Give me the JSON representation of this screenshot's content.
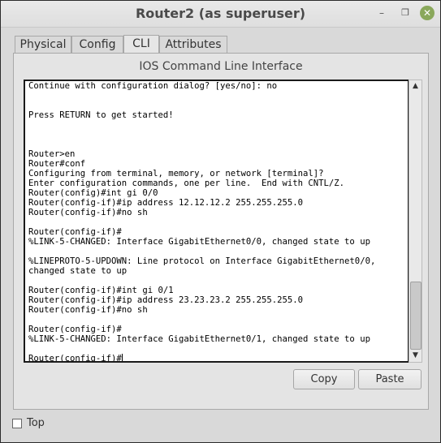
{
  "window": {
    "title": "Router2 (as superuser)",
    "controls": [
      "−",
      "❑",
      "✕"
    ]
  },
  "tabs": [
    {
      "label": "Physical"
    },
    {
      "label": "Config"
    },
    {
      "label": "CLI",
      "active": true
    },
    {
      "label": "Attributes"
    }
  ],
  "cli": {
    "heading": "IOS Command Line Interface",
    "lines": [
      "Continue with configuration dialog? [yes/no]: no",
      "",
      "",
      "Press RETURN to get started!",
      "",
      "",
      "",
      "Router>en",
      "Router#conf",
      "Configuring from terminal, memory, or network [terminal]?",
      "Enter configuration commands, one per line.  End with CNTL/Z.",
      "Router(config)#int gi 0/0",
      "Router(config-if)#ip address 12.12.12.2 255.255.255.0",
      "Router(config-if)#no sh",
      "",
      "Router(config-if)#",
      "%LINK-5-CHANGED: Interface GigabitEthernet0/0, changed state to up",
      "",
      "%LINEPROTO-5-UPDOWN: Line protocol on Interface GigabitEthernet0/0,",
      "changed state to up",
      "",
      "Router(config-if)#int gi 0/1",
      "Router(config-if)#ip address 23.23.23.2 255.255.255.0",
      "Router(config-if)#no sh",
      "",
      "Router(config-if)#",
      "%LINK-5-CHANGED: Interface GigabitEthernet0/1, changed state to up",
      "",
      "Router(config-if)#"
    ]
  },
  "buttons": {
    "copy": "Copy",
    "paste": "Paste"
  },
  "footer": {
    "top_label": "Top",
    "top_checked": false
  }
}
